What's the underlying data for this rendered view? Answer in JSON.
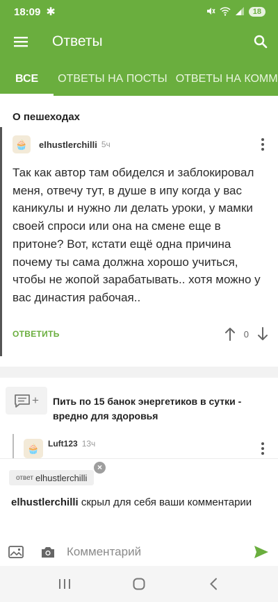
{
  "status": {
    "time": "18:09",
    "battery": "18"
  },
  "header": {
    "title": "Ответы"
  },
  "tabs": [
    {
      "label": "ВСЕ"
    },
    {
      "label": "ОТВЕТЫ НА ПОСТЫ"
    },
    {
      "label": "ОТВЕТЫ НА КОММЕНТАРИИ"
    }
  ],
  "post1": {
    "title": "О пешеходах",
    "comment": {
      "author": "elhustlerchilli",
      "time": "5ч",
      "text": "Так как автор там обиделся и заблокировал меня, отвечу тут, в душе в ипу когда у вас каникулы и нужно ли делать уроки, у мамки своей спроси или она на смене еще в притоне? Вот, кстати ещё одна причина почему ты сама должна хорошо учиться, чтобы не жопой зарабатывать.. хотя можно у вас династия рабочая..",
      "reply_label": "ОТВЕТИТЬ",
      "score": "0"
    }
  },
  "post2": {
    "title": "Пить по 15 банок энергетиков в сутки - вредно для здоровья",
    "comment": {
      "author": "Luft123",
      "time": "13ч"
    }
  },
  "reply": {
    "prefix": "ответ",
    "target": "elhustlerchilli",
    "notice_user": "elhustlerchilli",
    "notice_text": " скрыл для себя ваши комментарии"
  },
  "composer": {
    "placeholder": "Комментарий"
  },
  "colors": {
    "brand": "#6aae3e",
    "accent_text": "#6aae3e"
  },
  "icons": [
    "menu-icon",
    "search-icon",
    "arrow-up-icon",
    "arrow-down-icon",
    "image-icon",
    "camera-icon",
    "send-icon",
    "add-comment-icon"
  ]
}
